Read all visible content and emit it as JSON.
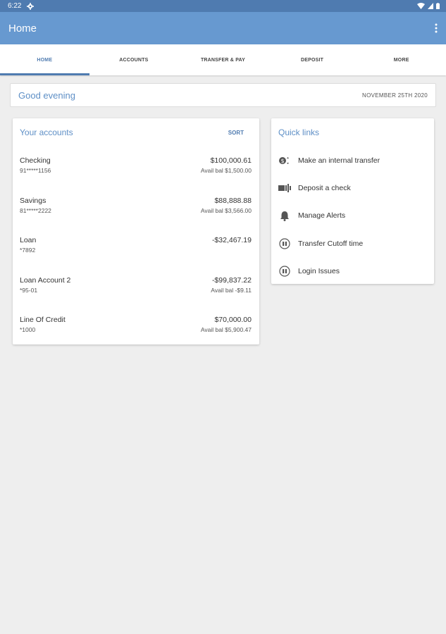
{
  "status_bar": {
    "time": "6:22"
  },
  "app_bar": {
    "title": "Home"
  },
  "tabs": [
    {
      "label": "HOME",
      "active": true
    },
    {
      "label": "ACCOUNTS",
      "active": false
    },
    {
      "label": "TRANSFER & PAY",
      "active": false
    },
    {
      "label": "DEPOSIT",
      "active": false
    },
    {
      "label": "MORE",
      "active": false
    }
  ],
  "greeting": {
    "text": "Good evening",
    "date": "NOVEMBER 25TH 2020"
  },
  "accounts": {
    "title": "Your accounts",
    "sort_label": "SORT",
    "items": [
      {
        "name": "Checking",
        "number": "91*****1156",
        "balance": "$100,000.61",
        "avail": "Avail bal $1,500.00"
      },
      {
        "name": "Savings",
        "number": "81*****2222",
        "balance": "$88,888.88",
        "avail": "Avail bal $3,566.00"
      },
      {
        "name": "Loan",
        "number": "*7892",
        "balance": "-$32,467.19",
        "avail": ""
      },
      {
        "name": "Loan Account 2",
        "number": "*95-01",
        "balance": "-$99,837.22",
        "avail": "Avail bal -$9.11"
      },
      {
        "name": "Line Of Credit",
        "number": "*1000",
        "balance": "$70,000.00",
        "avail": "Avail bal $5,900.47"
      }
    ]
  },
  "quick_links": {
    "title": "Quick links",
    "items": [
      {
        "label": "Make an internal transfer",
        "icon": "transfer-icon"
      },
      {
        "label": "Deposit a check",
        "icon": "check-deposit-icon"
      },
      {
        "label": "Manage Alerts",
        "icon": "bell-icon"
      },
      {
        "label": "Transfer Cutoff time",
        "icon": "link-icon"
      },
      {
        "label": "Login Issues",
        "icon": "link-icon"
      }
    ]
  },
  "colors": {
    "primary": "#6799d0",
    "status": "#4f7bb0",
    "accent": "#5e8fc6",
    "background": "#eeeeee"
  }
}
